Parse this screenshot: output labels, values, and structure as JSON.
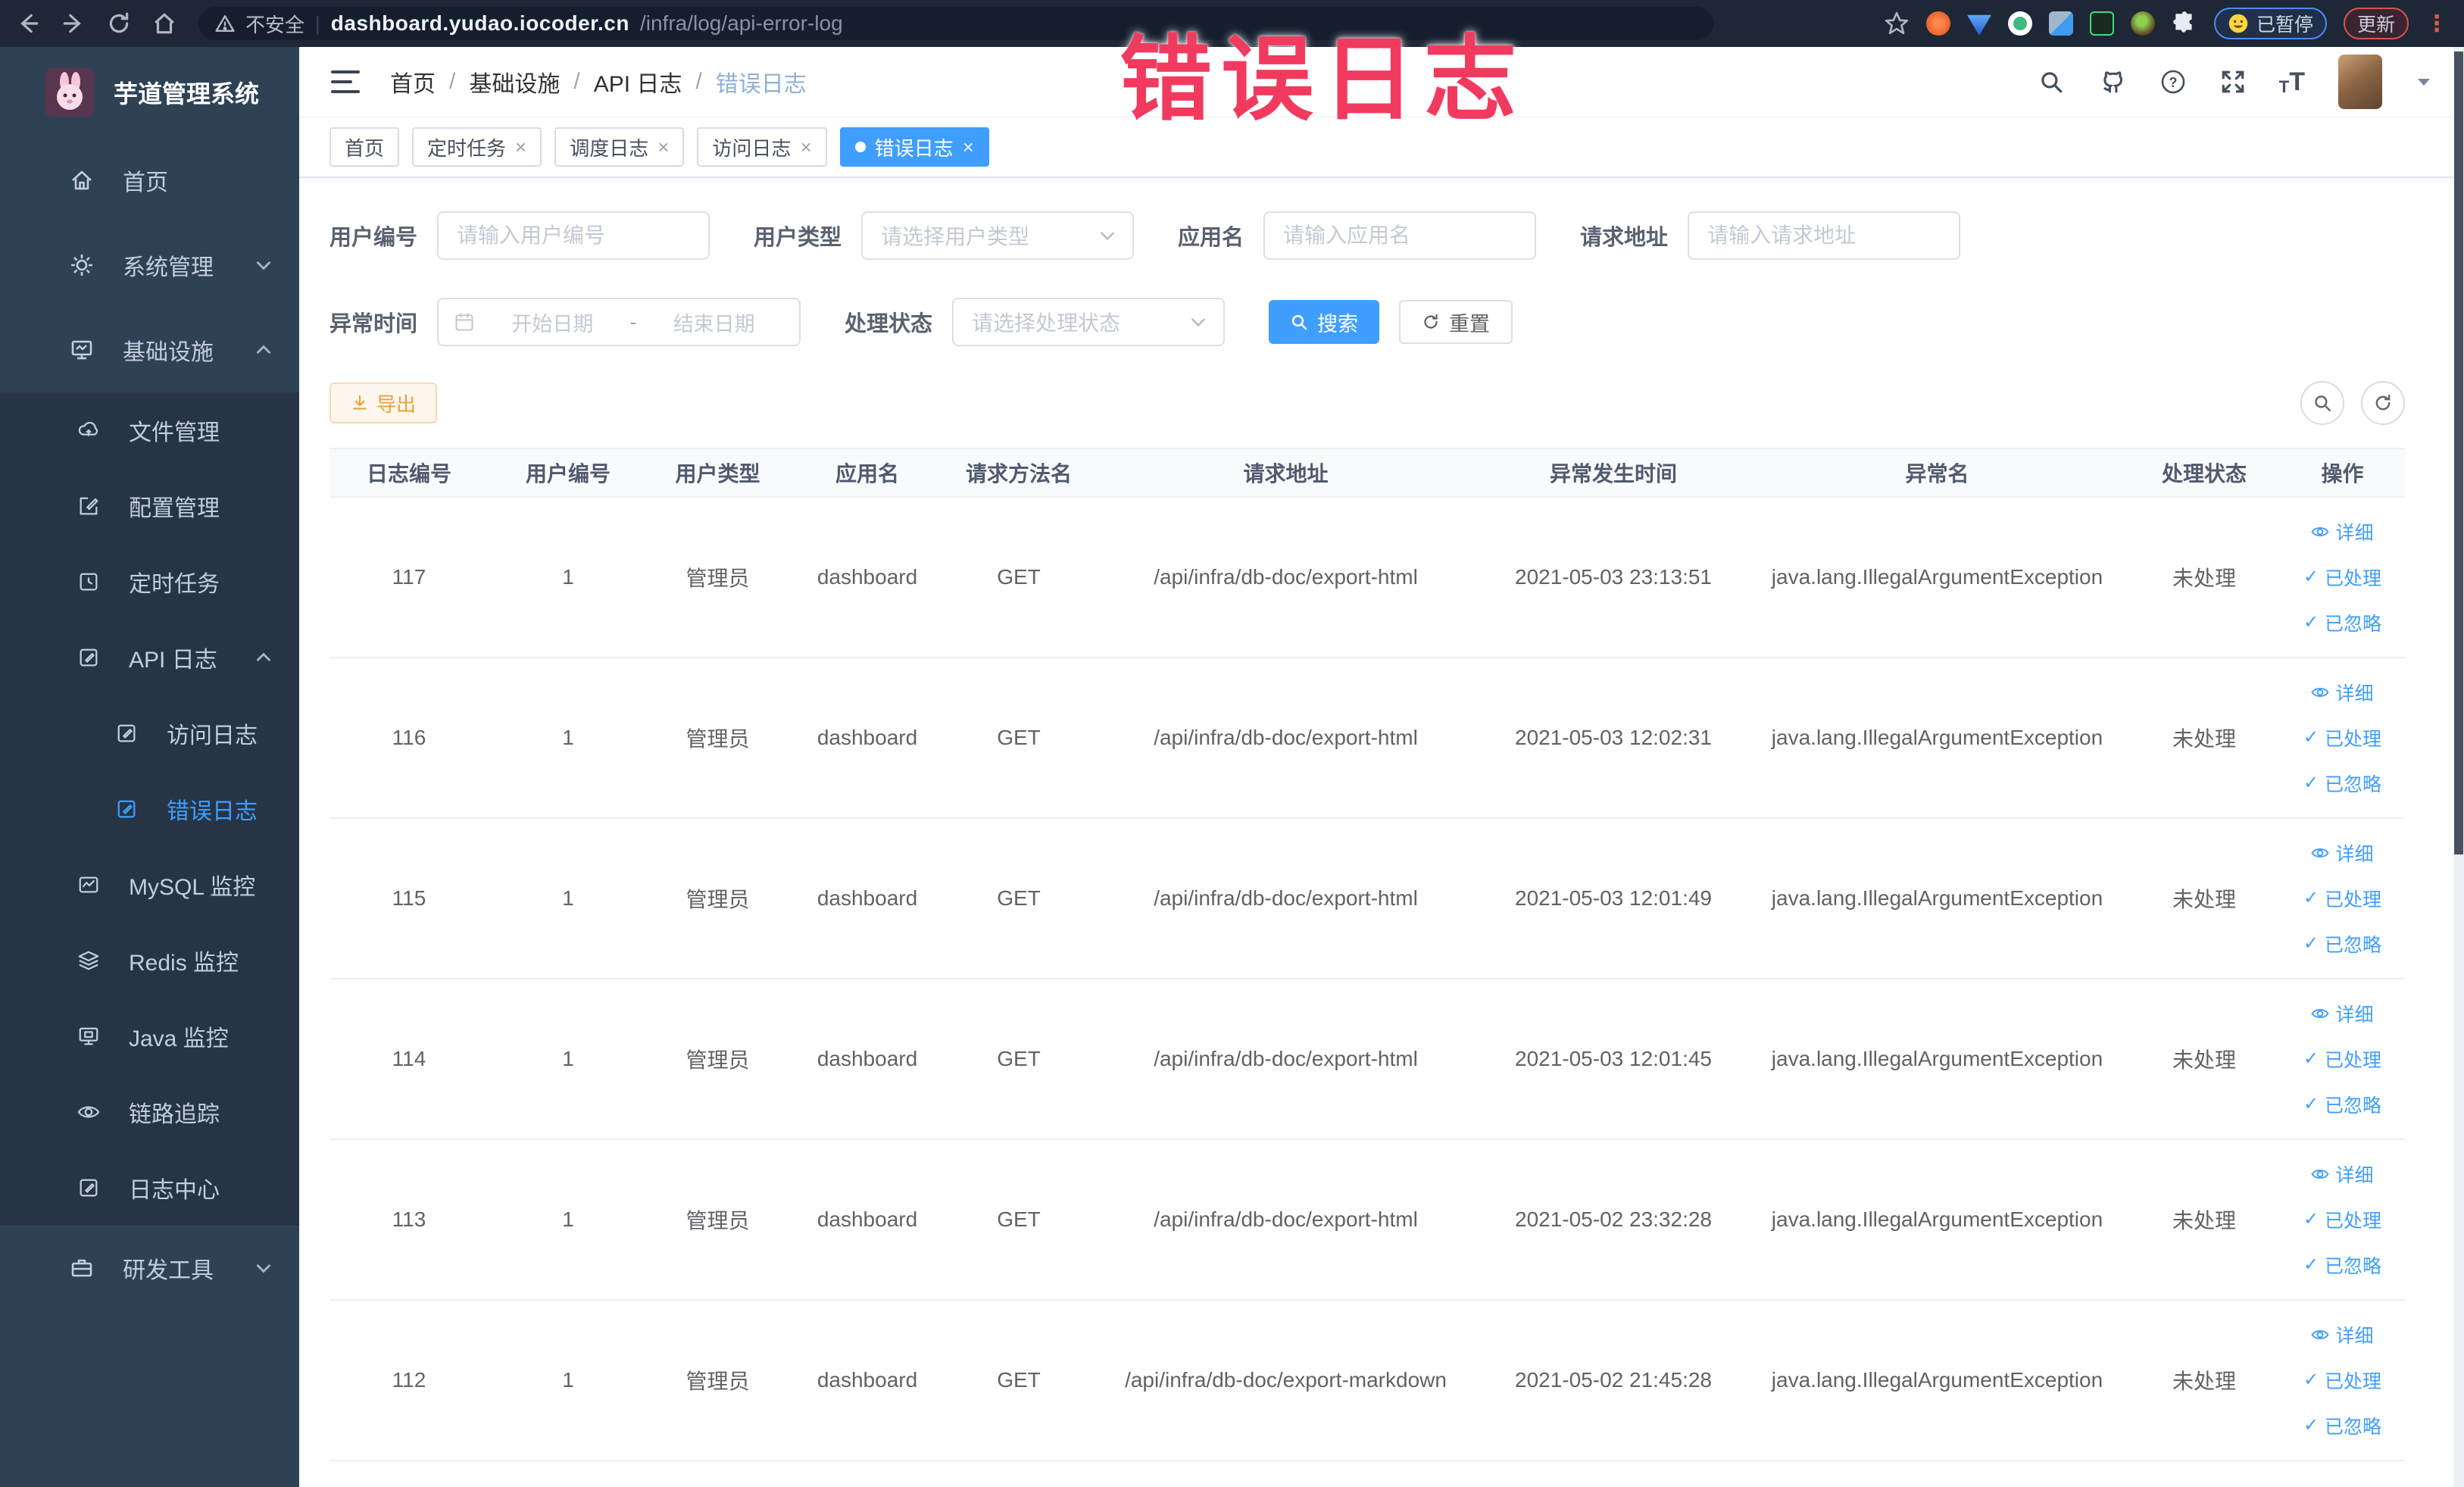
{
  "annotation": {
    "text": "错误日志"
  },
  "browser": {
    "security_label": "不安全",
    "url_host": "dashboard.yudao.iocoder.cn",
    "url_path": "/infra/log/api-error-log",
    "url_divider": "|",
    "paused_badge_label": "已暂停",
    "update_button_label": "更新",
    "menu_dots_glyph": "⋮"
  },
  "sidebar": {
    "app_title": "芋道管理系统",
    "menu": {
      "home": "首页",
      "system": "系统管理",
      "infra": "基础设施",
      "file": "文件管理",
      "config": "配置管理",
      "job": "定时任务",
      "api_log": "API 日志",
      "access_log": "访问日志",
      "error_log": "错误日志",
      "mysql": "MySQL 监控",
      "redis": "Redis 监控",
      "java": "Java 监控",
      "trace": "链路追踪",
      "log_center": "日志中心",
      "dev_tools": "研发工具"
    }
  },
  "header": {
    "breadcrumb": [
      "首页",
      "基础设施",
      "API 日志",
      "错误日志"
    ],
    "separator": "/",
    "help_glyph": "?",
    "font_small_glyph": "T",
    "font_big_glyph": "T"
  },
  "tabs": {
    "close_glyph": "×",
    "items": [
      {
        "label": "首页"
      },
      {
        "label": "定时任务"
      },
      {
        "label": "调度日志"
      },
      {
        "label": "访问日志"
      },
      {
        "label": "错误日志"
      }
    ]
  },
  "filters": {
    "user_id": {
      "label": "用户编号",
      "placeholder": "请输入用户编号"
    },
    "user_type": {
      "label": "用户类型",
      "placeholder": "请选择用户类型"
    },
    "app_name": {
      "label": "应用名",
      "placeholder": "请输入应用名"
    },
    "request_url": {
      "label": "请求地址",
      "placeholder": "请输入请求地址"
    },
    "exception_time": {
      "label": "异常时间",
      "start_placeholder": "开始日期",
      "separator": "-",
      "end_placeholder": "结束日期"
    },
    "process_status": {
      "label": "处理状态",
      "placeholder": "请选择处理状态"
    },
    "search_button": "搜索",
    "reset_button": "重置"
  },
  "toolbar": {
    "export_button": "导出"
  },
  "table": {
    "headers": [
      "日志编号",
      "用户编号",
      "用户类型",
      "应用名",
      "请求方法名",
      "请求地址",
      "异常发生时间",
      "异常名",
      "处理状态",
      "操作"
    ],
    "actions": {
      "detail": "详细",
      "processed": "已处理",
      "ignored": "已忽略",
      "check_glyph": "✓"
    },
    "rows": [
      {
        "id": "117",
        "user_id": "1",
        "user_type": "管理员",
        "app_name": "dashboard",
        "method": "GET",
        "url": "/api/infra/db-doc/export-html",
        "time": "2021-05-03 23:13:51",
        "exception": "java.lang.IllegalArgumentException",
        "status": "未处理"
      },
      {
        "id": "116",
        "user_id": "1",
        "user_type": "管理员",
        "app_name": "dashboard",
        "method": "GET",
        "url": "/api/infra/db-doc/export-html",
        "time": "2021-05-03 12:02:31",
        "exception": "java.lang.IllegalArgumentException",
        "status": "未处理"
      },
      {
        "id": "115",
        "user_id": "1",
        "user_type": "管理员",
        "app_name": "dashboard",
        "method": "GET",
        "url": "/api/infra/db-doc/export-html",
        "time": "2021-05-03 12:01:49",
        "exception": "java.lang.IllegalArgumentException",
        "status": "未处理"
      },
      {
        "id": "114",
        "user_id": "1",
        "user_type": "管理员",
        "app_name": "dashboard",
        "method": "GET",
        "url": "/api/infra/db-doc/export-html",
        "time": "2021-05-03 12:01:45",
        "exception": "java.lang.IllegalArgumentException",
        "status": "未处理"
      },
      {
        "id": "113",
        "user_id": "1",
        "user_type": "管理员",
        "app_name": "dashboard",
        "method": "GET",
        "url": "/api/infra/db-doc/export-html",
        "time": "2021-05-02 23:32:28",
        "exception": "java.lang.IllegalArgumentException",
        "status": "未处理"
      },
      {
        "id": "112",
        "user_id": "1",
        "user_type": "管理员",
        "app_name": "dashboard",
        "method": "GET",
        "url": "/api/infra/db-doc/export-markdown",
        "time": "2021-05-02 21:45:28",
        "exception": "java.lang.IllegalArgumentException",
        "status": "未处理"
      }
    ]
  },
  "colors": {
    "primary": "#409eff",
    "annotation": "#f23a5e",
    "warning": "#e6a23c",
    "sidebar_bg": "#2f4155",
    "submenu_bg": "#263446"
  }
}
